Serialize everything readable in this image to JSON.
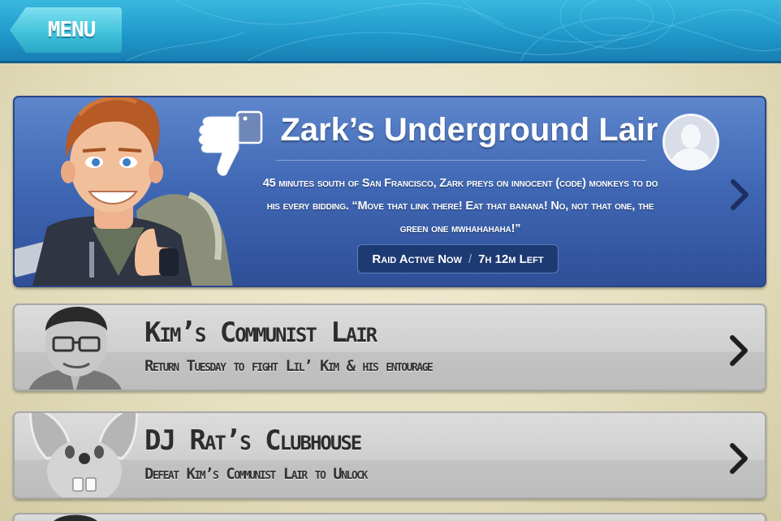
{
  "topbar": {
    "menu_label": "MENU"
  },
  "lairs": [
    {
      "title": "Zark’s Underground Lair",
      "description": "45 minutes south of San Francisco, Zark preys on innocent (code) monkeys to do his every bidding. “Move that link there! Eat that banana! No, not that one, the green one mwhahahaha!”",
      "status": "Raid Active Now",
      "separator": "/",
      "time_left": "7h 12m Left",
      "icons": [
        "thumbs-down-icon",
        "profile-avatar-icon",
        "chevron-right-icon"
      ]
    },
    {
      "title": "Kim’s Communist Lair",
      "subtitle": "Return Tuesday to fight Lil’ Kim & his entourage"
    },
    {
      "title": "DJ Rat’s Clubhouse",
      "subtitle": "Defeat Kim’s Communist Lair to Unlock"
    }
  ],
  "colors": {
    "topbar": "#1f97c9",
    "menu_button": "#43c3dc",
    "active_card": "#3f66b3",
    "locked_card": "#cfcfcf",
    "background": "#e6dfbf"
  }
}
